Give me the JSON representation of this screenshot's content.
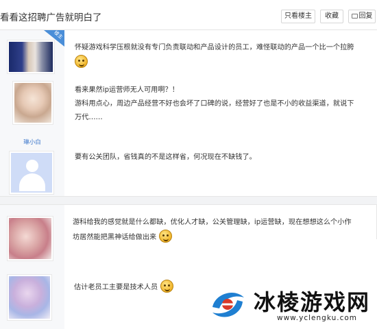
{
  "header": {
    "title": "看看这招聘广告就明白了",
    "only_owner_label": "只看楼主",
    "favorite_label": "收藏",
    "reply_label": "回复"
  },
  "posts": [
    {
      "is_owner": true,
      "owner_badge": "楼主",
      "avatar_icon": "pixelated-avatar",
      "lines": [
        "怀疑游戏科学压根就没有专门负责联动和产品设计的员工，难怪联动的产品一个比一个拉胯"
      ],
      "has_emoji": true
    },
    {
      "username": "琳小白",
      "avatar_icon": "pixelated-avatar",
      "lines": [
        "看来果然ip运营师无人可用啊？！",
        "游科用点心，周边产品经营不好也会坏了口碑的说，经营好了也是不小的收益渠道，就说下",
        "万代……"
      ]
    },
    {
      "avatar_icon": "default-user-avatar",
      "lines": [
        "要有公关团队，省钱真的不是这样省，何况现在不缺钱了。"
      ]
    },
    {
      "avatar_icon": "pixelated-avatar",
      "lines": [
        "游科给我的感觉就是什么都缺，优化人才缺，公关管理缺，ip运营缺，现在想想这么个小作",
        "坊居然能把黑神话给做出来"
      ],
      "has_emoji": true
    },
    {
      "avatar_icon": "pixelated-avatar",
      "lines": [
        "估计老员工主要是技术人员"
      ],
      "has_emoji": true
    }
  ],
  "watermark": {
    "brand": "冰棱游戏网",
    "url": "www.yclengku.com"
  },
  "colors": {
    "accent": "#4a8ed8",
    "username": "#3572c9",
    "sidebar_bg": "#f7f8fa"
  }
}
